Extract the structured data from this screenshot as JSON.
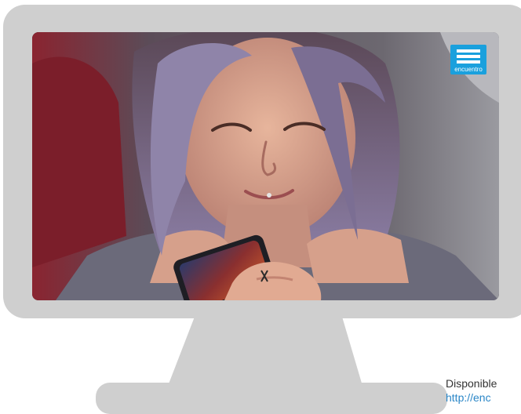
{
  "brand": {
    "logo_text": "encuentro",
    "logo_color": "#1aa0dd"
  },
  "caption": {
    "line1": "Disponible",
    "line2": "http://enc"
  },
  "colors": {
    "monitor_gray": "#cfcfcf",
    "link_blue": "#2a86c7"
  },
  "icons": {
    "monitor": "monitor-icon",
    "logo": "encuentro-logo-icon"
  }
}
